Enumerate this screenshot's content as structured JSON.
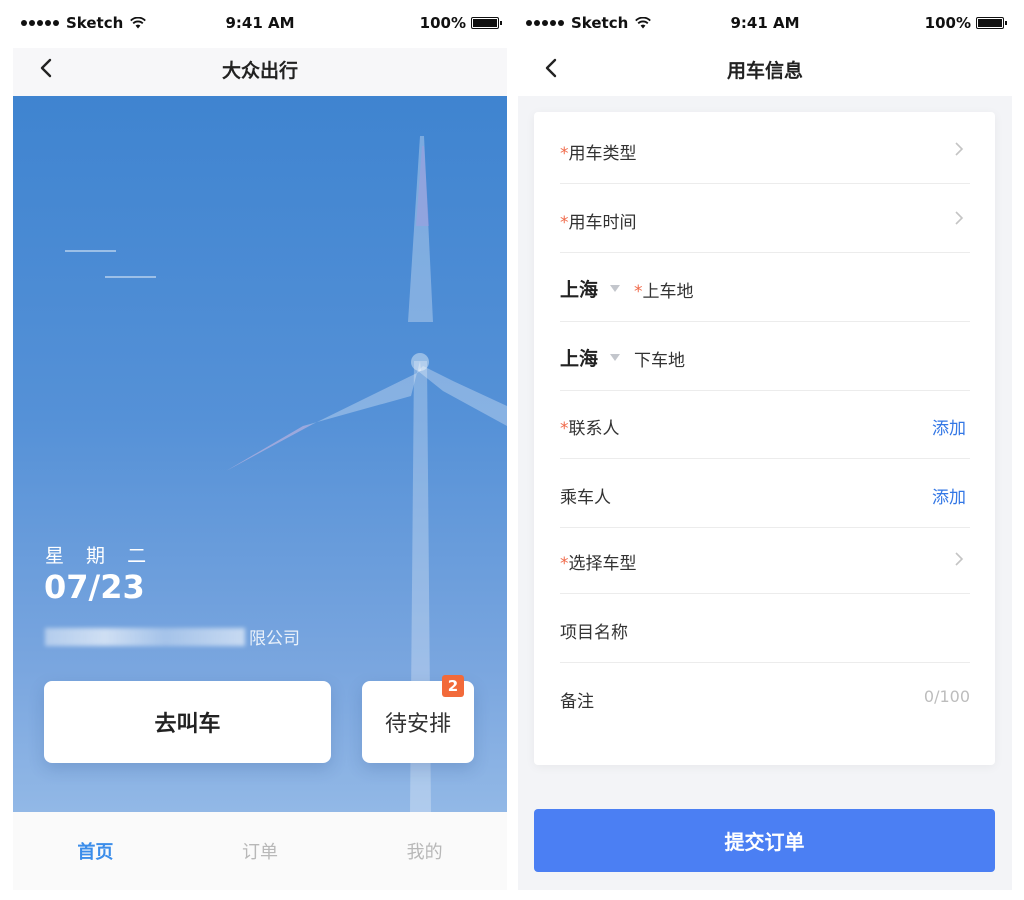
{
  "status_bar": {
    "carrier": "Sketch",
    "time": "9:41 AM",
    "battery": "100%"
  },
  "left_screen": {
    "nav_title": "大众出行",
    "weekday": "星 期 二",
    "date": "07/23",
    "company_suffix": "限公司",
    "call_car_label": "去叫车",
    "pending_label": "待安排",
    "pending_badge": "2",
    "tabs": [
      {
        "label": "首页",
        "active": true
      },
      {
        "label": "订单",
        "active": false
      },
      {
        "label": "我的",
        "active": false
      }
    ],
    "colors": {
      "active_tab": "#3b8dea",
      "badge": "#f26a3a",
      "hero_top": "#3f84d0"
    }
  },
  "right_screen": {
    "nav_title": "用车信息",
    "required_mark": "*",
    "fields": {
      "car_type": "用车类型",
      "car_time": "用车时间",
      "pickup_city": "上海",
      "pickup_label": "上车地",
      "dropoff_city": "上海",
      "dropoff_label": "下车地",
      "contact_label": "联系人",
      "contact_action": "添加",
      "passenger_label": "乘车人",
      "passenger_action": "添加",
      "vehicle_model": "选择车型",
      "project_name": "项目名称",
      "remark_label": "备注",
      "remark_counter": "0/100"
    },
    "submit_label": "提交订单",
    "colors": {
      "submit": "#4b7ff3",
      "required": "#f06a4a",
      "link": "#3377e5"
    }
  }
}
